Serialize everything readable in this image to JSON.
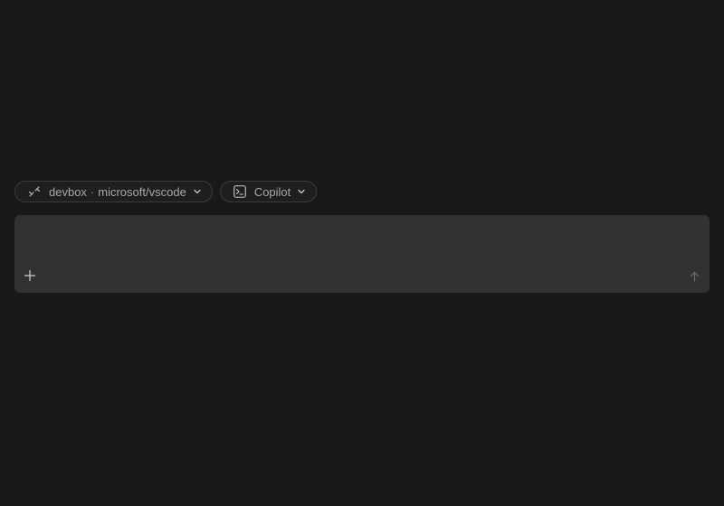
{
  "chips": {
    "remote": {
      "icon": "remote-connection-icon",
      "host": "devbox",
      "separator": "·",
      "repo": "microsoft/vscode",
      "dropdown_icon": "chevron-down-icon"
    },
    "agent": {
      "icon": "terminal-icon",
      "label": "Copilot",
      "dropdown_icon": "chevron-down-icon"
    }
  },
  "composer": {
    "value": "",
    "placeholder": "",
    "add_icon": "plus-icon",
    "send_icon": "arrow-up-icon"
  },
  "colors": {
    "background": "#191919",
    "composer": "#323232",
    "chip_border": "#3b3b3b",
    "text_muted": "#a8a8a8"
  }
}
